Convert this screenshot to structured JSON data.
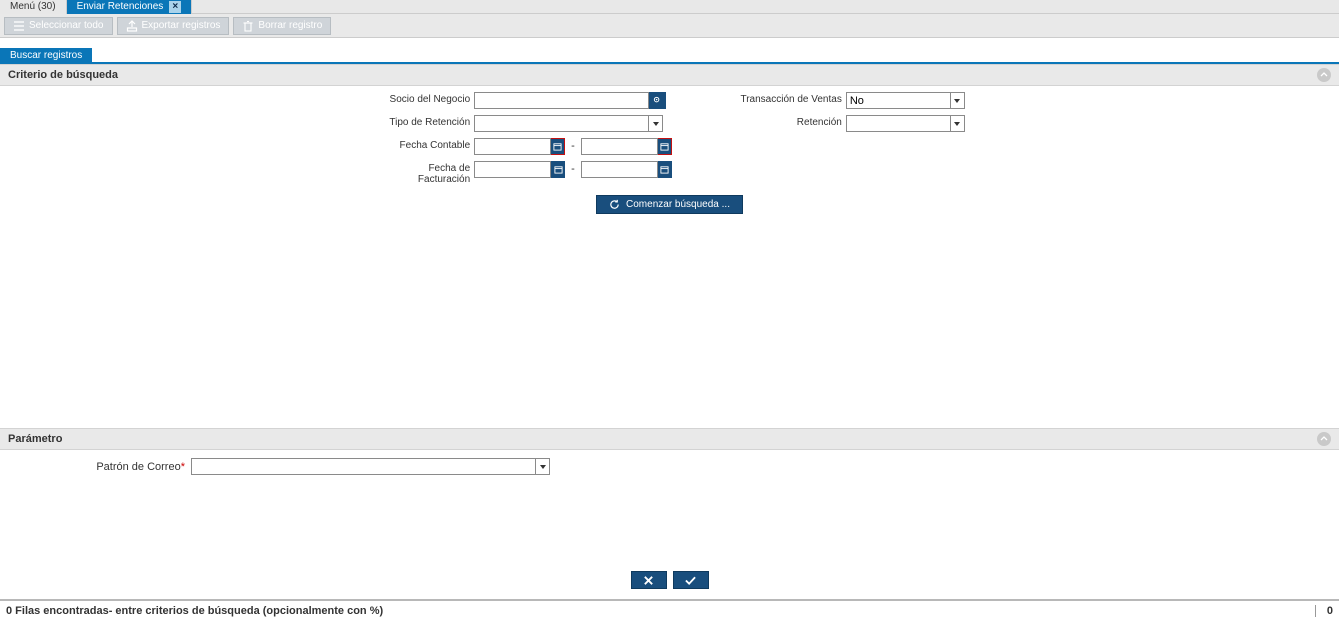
{
  "tabs": {
    "menu": "Menú (30)",
    "active": "Enviar Retenciones"
  },
  "toolbar": {
    "select_all": "Seleccionar todo",
    "export": "Exportar registros",
    "delete": "Borrar registro"
  },
  "subtab": {
    "search": "Buscar registros"
  },
  "sections": {
    "criteria": "Criterio de búsqueda",
    "param": "Parámetro"
  },
  "fields": {
    "socio": "Socio del Negocio",
    "tipo_ret": "Tipo de Retención",
    "fecha_cont": "Fecha Contable",
    "fecha_fact": "Fecha de Facturación",
    "trans_ventas": "Transacción de Ventas",
    "retencion": "Retención",
    "trans_ventas_val": "No",
    "patron_correo": "Patrón de Correo"
  },
  "buttons": {
    "start_search": "Comenzar búsqueda ..."
  },
  "status": {
    "left": "0 Filas encontradas- entre criterios de búsqueda (opcionalmente con %)",
    "right": "0"
  }
}
